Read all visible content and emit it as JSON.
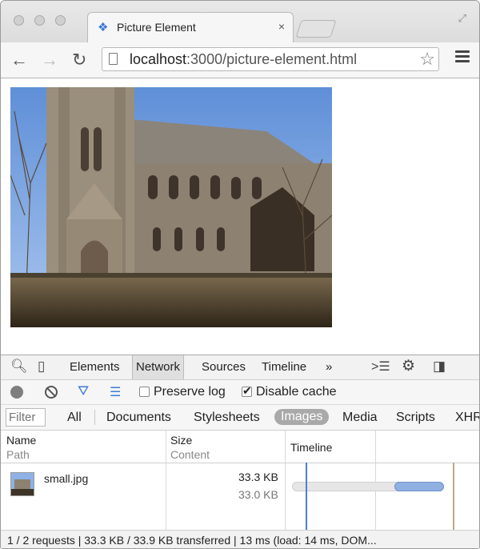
{
  "browser": {
    "tab_title": "Picture Element",
    "tab_close": "×",
    "url_host": "localhost",
    "url_path": ":3000/picture-element.html"
  },
  "devtools": {
    "tabs": [
      "Elements",
      "Network",
      "Sources",
      "Timeline"
    ],
    "more": "»",
    "toolbar": {
      "preserve_log": "Preserve log",
      "disable_cache": "Disable cache",
      "preserve_log_checked": false,
      "disable_cache_checked": true
    },
    "filter": {
      "placeholder": "Filter",
      "types": [
        "All",
        "Documents",
        "Stylesheets",
        "Images",
        "Media",
        "Scripts",
        "XHR"
      ],
      "active": "Images"
    },
    "table": {
      "headers": {
        "name": "Name",
        "path": "Path",
        "size": "Size",
        "content": "Content",
        "timeline": "Timeline"
      },
      "rows": [
        {
          "name": "small.jpg",
          "size": "33.3 KB",
          "content": "33.0 KB"
        }
      ]
    },
    "status": "1 / 2 requests | 33.3 KB / 33.9 KB transferred | 13 ms (load: 14 ms, DOM..."
  }
}
